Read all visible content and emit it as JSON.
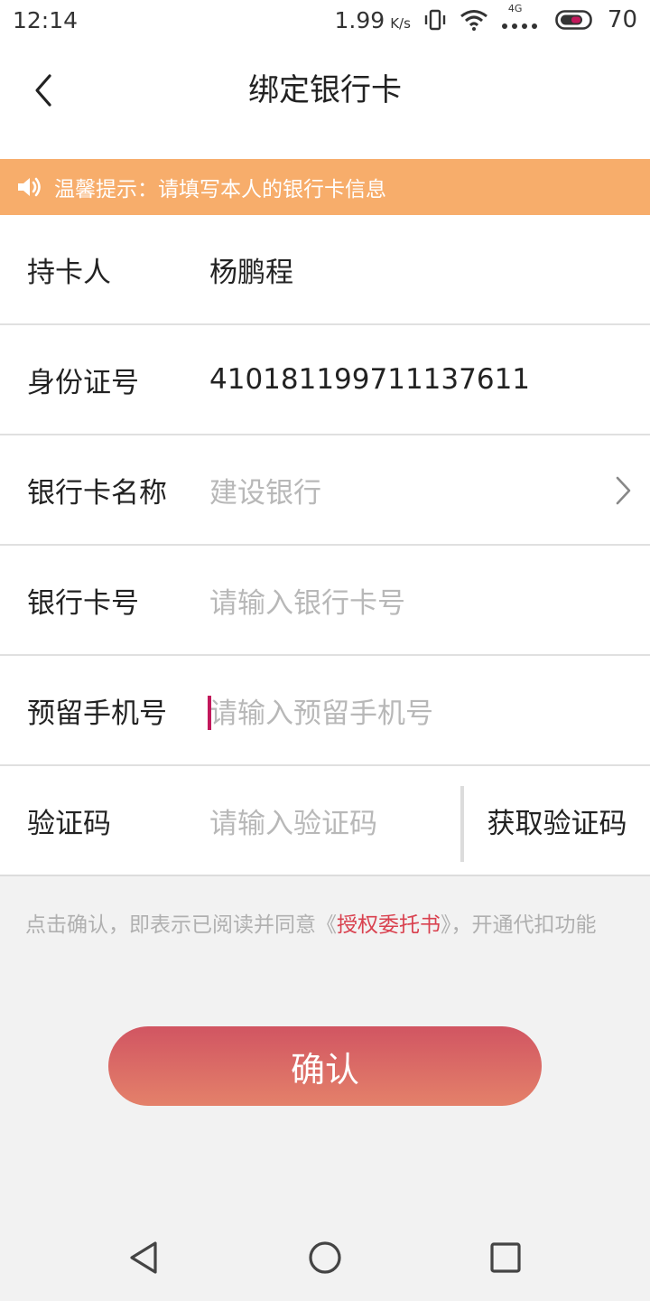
{
  "status_bar": {
    "time": "12:14",
    "network_speed": "1.99",
    "speed_unit": "K/s",
    "network_type": "4G",
    "battery": "70",
    "icons": [
      "vibrate-icon",
      "wifi-icon",
      "signal-icon",
      "battery-icon"
    ]
  },
  "header": {
    "back_icon": "chevron-left-icon",
    "title": "绑定银行卡"
  },
  "tip": {
    "icon": "speaker-icon",
    "text": "温馨提示：请填写本人的银行卡信息"
  },
  "form": {
    "holder": {
      "label": "持卡人",
      "value": "杨鹏程"
    },
    "id_number": {
      "label": "身份证号",
      "value": "410181199711137611"
    },
    "bank_name": {
      "label": "银行卡名称",
      "placeholder": "建设银行",
      "icon": "chevron-right-icon"
    },
    "card_number": {
      "label": "银行卡号",
      "placeholder": "请输入银行卡号"
    },
    "phone": {
      "label": "预留手机号",
      "placeholder": "请输入预留手机号"
    },
    "code": {
      "label": "验证码",
      "placeholder": "请输入验证码",
      "button": "获取验证码"
    }
  },
  "agreement": {
    "prefix": "点击确认，即表示已阅读并同意《",
    "link": "授权委托书",
    "suffix": "》，开通代扣功能"
  },
  "confirm_button": "确认",
  "colors": {
    "banner": "#f7ad6b",
    "link": "#d9414f",
    "button_top": "#d15562",
    "button_bottom": "#e4816a",
    "cursor": "#c2185b"
  },
  "system_nav": [
    "back-triangle-icon",
    "home-circle-icon",
    "recents-square-icon"
  ]
}
